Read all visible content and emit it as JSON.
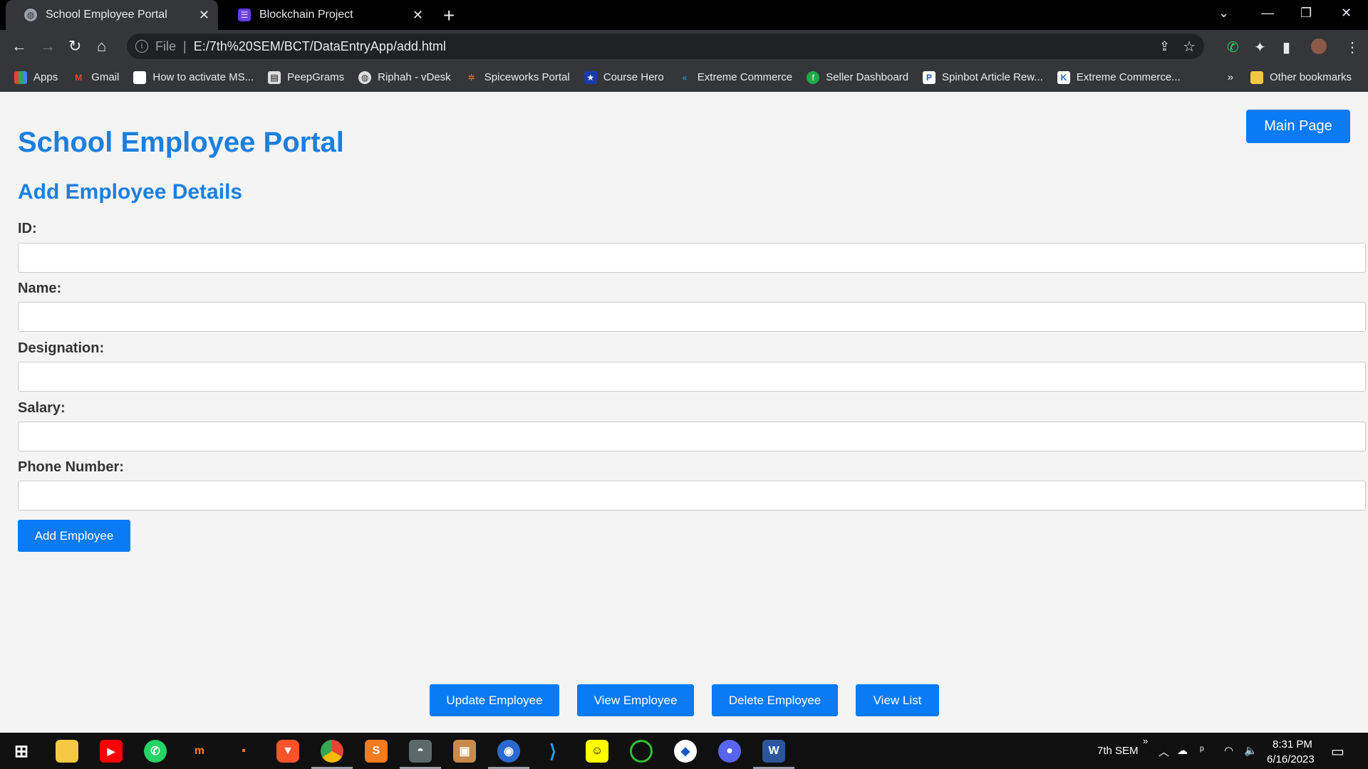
{
  "browser": {
    "tabs": [
      {
        "label": "School Employee Portal",
        "active": true
      },
      {
        "label": "Blockchain Project",
        "active": false
      }
    ],
    "address": {
      "protocol": "File",
      "url": "E:/7th%20SEM/BCT/DataEntryApp/add.html"
    },
    "bookmarks": [
      {
        "label": "Apps",
        "icon": "apps-grid-icon"
      },
      {
        "label": "Gmail",
        "icon": "gmail-icon"
      },
      {
        "label": "How to activate MS...",
        "icon": "page-icon"
      },
      {
        "label": "PeepGrams",
        "icon": "page-icon"
      },
      {
        "label": "Riphah - vDesk",
        "icon": "globe-icon"
      },
      {
        "label": "Spiceworks Portal",
        "icon": "spiceworks-icon"
      },
      {
        "label": "Course Hero",
        "icon": "coursehero-icon"
      },
      {
        "label": "Extreme Commerce",
        "icon": "extreme-commerce-icon"
      },
      {
        "label": "Seller Dashboard",
        "icon": "seller-icon"
      },
      {
        "label": "Spinbot Article Rew...",
        "icon": "spinbot-icon"
      },
      {
        "label": "Extreme Commerce...",
        "icon": "extreme-commerce-icon"
      }
    ],
    "overflow": "»",
    "other_bookmarks": "Other bookmarks"
  },
  "page": {
    "title": "School Employee Portal",
    "subtitle": "Add Employee Details",
    "main_page_button": "Main Page",
    "fields": [
      {
        "label": "ID:",
        "value": ""
      },
      {
        "label": "Name:",
        "value": ""
      },
      {
        "label": "Designation:",
        "value": ""
      },
      {
        "label": "Salary:",
        "value": ""
      },
      {
        "label": "Phone Number:",
        "value": ""
      }
    ],
    "add_button": "Add Employee",
    "nav_buttons": [
      "Update Employee",
      "View Employee",
      "Delete Employee",
      "View List"
    ],
    "accent_color": "#1a7fe0",
    "button_color": "#0a7af5"
  },
  "taskbar": {
    "apps": [
      "start-icon",
      "file-explorer-icon",
      "youtube-icon",
      "whatsapp-icon",
      "moodle-icon",
      "app-icon",
      "brave-icon",
      "chrome-icon",
      "sublime-icon",
      "app-icon",
      "box-icon",
      "browser-icon",
      "vscode-icon",
      "snapchat-icon",
      "app-icon",
      "app-icon",
      "discord-icon",
      "word-icon"
    ],
    "folder_label": "7th SEM",
    "time": "8:31 PM",
    "date": "6/16/2023"
  }
}
